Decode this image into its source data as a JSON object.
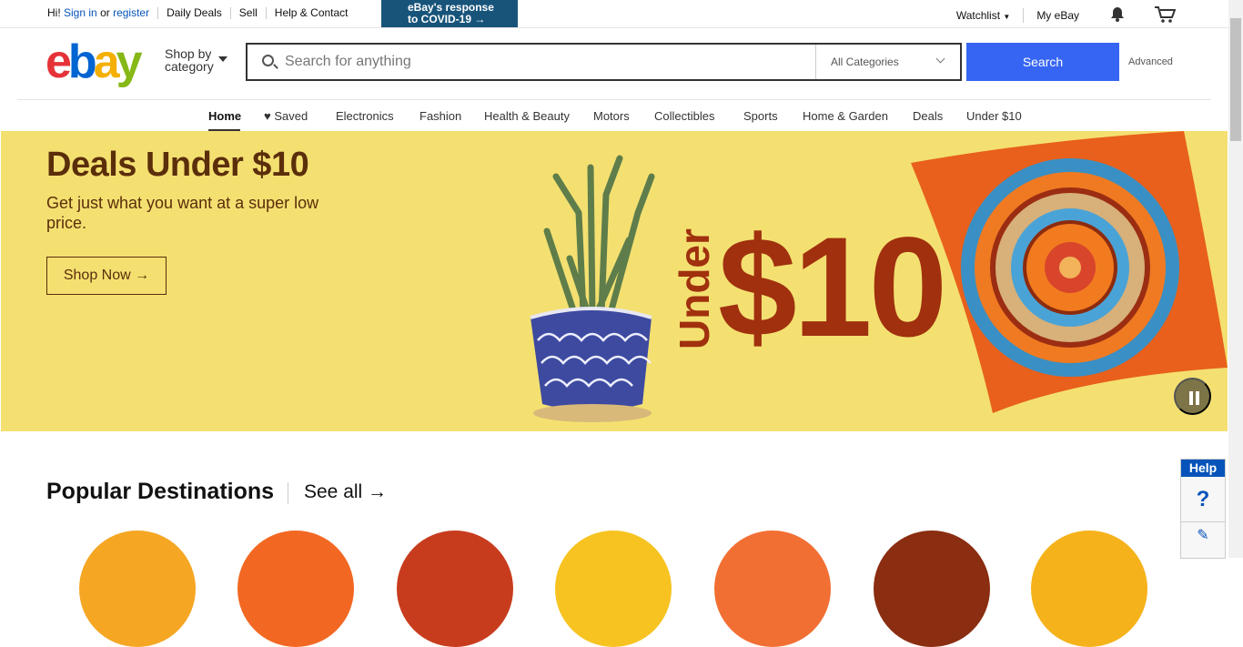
{
  "topbar": {
    "greeting": "Hi!",
    "sign_in": "Sign in",
    "or": "or",
    "register": "register",
    "links": [
      "Daily Deals",
      "Sell",
      "Help & Contact"
    ],
    "covid_line1": "eBay's response",
    "covid_line2": "to COVID-19 →",
    "watchlist": "Watchlist",
    "my_ebay": "My eBay"
  },
  "header": {
    "logo": [
      "e",
      "b",
      "a",
      "y"
    ],
    "shop_by_1": "Shop by",
    "shop_by_2": "category",
    "search_placeholder": "Search for anything",
    "category_select": "All Categories",
    "search_button": "Search",
    "advanced": "Advanced"
  },
  "nav": {
    "items": [
      "Home",
      "♥ Saved",
      "Electronics",
      "Fashion",
      "Health & Beauty",
      "Motors",
      "Collectibles",
      "Sports",
      "Home & Garden",
      "Deals",
      "Under $10"
    ]
  },
  "banner": {
    "title": "Deals Under $10",
    "subtitle": "Get just what you want at a super low price.",
    "cta": "Shop Now →",
    "art_under": "Under",
    "art_price": "$10"
  },
  "popular": {
    "title": "Popular Destinations",
    "see_all": "See all →"
  },
  "help": {
    "label": "Help",
    "question": "?",
    "feedback": "✎"
  }
}
